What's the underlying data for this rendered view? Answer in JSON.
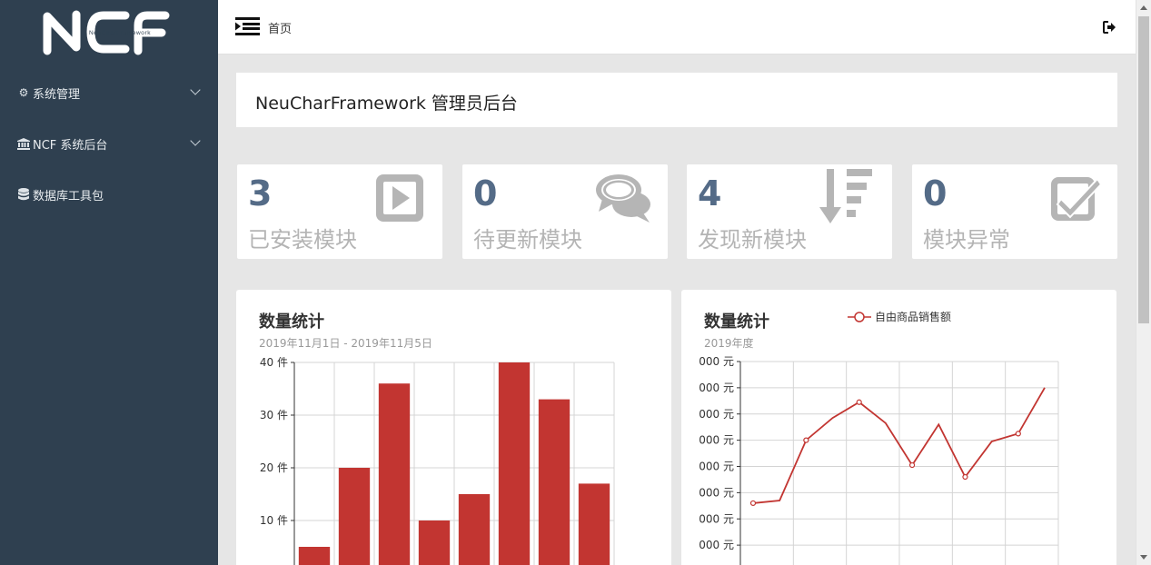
{
  "sidebar": {
    "logo_text": "NCF",
    "logo_subtext": "NeuCharFramework",
    "items": [
      {
        "label": "系统管理",
        "icon": "gear-icon",
        "has_children": true
      },
      {
        "label": "NCF 系统后台",
        "icon": "bank-icon",
        "has_children": true
      },
      {
        "label": "数据库工具包",
        "icon": "database-icon",
        "has_children": false
      }
    ]
  },
  "topbar": {
    "breadcrumb": "首页",
    "menu_icon": "menu-toggle-icon",
    "logout_icon": "sign-out-icon"
  },
  "header": {
    "title": "NeuCharFramework 管理员后台"
  },
  "stats": [
    {
      "value": "3",
      "label": "已安装模块",
      "icon": "play-square-icon"
    },
    {
      "value": "0",
      "label": "待更新模块",
      "icon": "comments-icon"
    },
    {
      "value": "4",
      "label": "发现新模块",
      "icon": "sort-amount-desc-icon"
    },
    {
      "value": "0",
      "label": "模块异常",
      "icon": "check-square-icon"
    }
  ],
  "colors": {
    "sidebar": "#2f4050",
    "accent": "#c23531",
    "stat_number": "#546b87"
  },
  "chart_data": [
    {
      "type": "bar",
      "title": "数量统计",
      "subtitle": "2019年11月1日 - 2019年11月5日",
      "y_ticks": [
        "10 件",
        "20 件",
        "30 件",
        "40 件"
      ],
      "ylim": [
        0,
        40
      ],
      "values": [
        5,
        20,
        36,
        10,
        15,
        40,
        33,
        17
      ],
      "grid": true
    },
    {
      "type": "line",
      "title": "数量统计",
      "subtitle": "2019年度",
      "legend": "自由商品销售额",
      "legend_position": "top",
      "y_ticks": [
        "000 元",
        "000 元",
        "000 元",
        "000 元",
        "000 元",
        "000 元",
        "000 元",
        "000 元"
      ],
      "ylim": [
        0,
        8
      ],
      "values": [
        2.6,
        2.7,
        5.0,
        5.85,
        6.45,
        5.65,
        4.05,
        5.6,
        3.6,
        4.95,
        5.25,
        7.0
      ],
      "grid": true
    }
  ]
}
